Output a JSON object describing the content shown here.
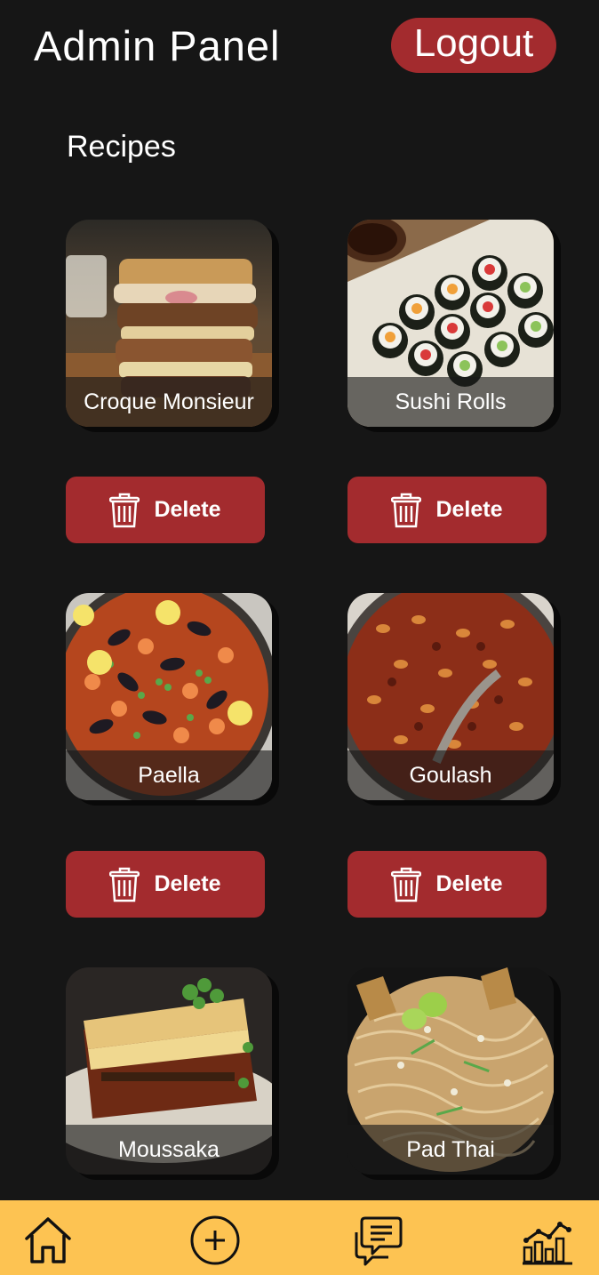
{
  "header": {
    "title": "Admin Panel",
    "logout_label": "Logout"
  },
  "section_title": "Recipes",
  "recipes": [
    {
      "name": "Croque Monsieur",
      "delete_label": "Delete"
    },
    {
      "name": "Sushi Rolls",
      "delete_label": "Delete"
    },
    {
      "name": "Paella",
      "delete_label": "Delete"
    },
    {
      "name": "Goulash",
      "delete_label": "Delete"
    },
    {
      "name": "Moussaka"
    },
    {
      "name": "Pad Thai"
    }
  ],
  "bottom_nav": [
    {
      "icon": "home-icon"
    },
    {
      "icon": "add-circle-icon"
    },
    {
      "icon": "chat-icon"
    },
    {
      "icon": "stats-chart-icon"
    }
  ],
  "colors": {
    "background": "#161616",
    "accent_red": "#a32b2e",
    "nav_yellow": "#fdc352",
    "text": "#ffffff"
  }
}
